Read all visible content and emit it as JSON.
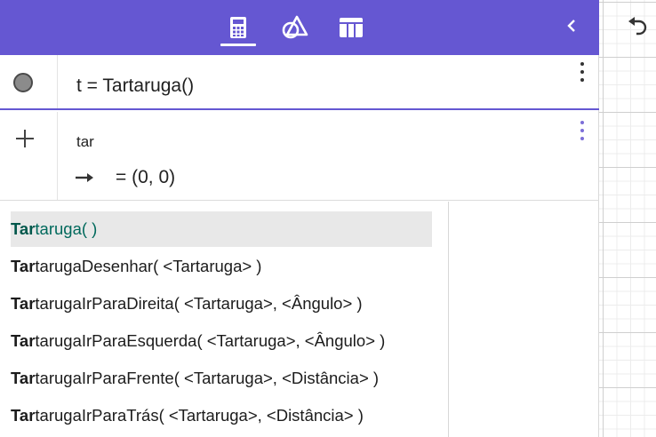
{
  "toolbar": {
    "tabs": [
      {
        "icon": "calculator-icon",
        "active": true
      },
      {
        "icon": "geometry-tools-icon",
        "active": false
      },
      {
        "icon": "table-icon",
        "active": false
      }
    ],
    "collapse_icon": "chevron-left-icon",
    "color": "#6557d2"
  },
  "graphics": {
    "undo_icon": "undo-icon"
  },
  "algebra": {
    "row1": {
      "expression": "t = Tartaruga()",
      "visibility_icon": "visibility-dot-icon"
    },
    "row2": {
      "input": "tar",
      "preview": "= (0, 0)",
      "add_icon": "plus-icon"
    }
  },
  "suggestions": {
    "typed": "Tar",
    "items": [
      {
        "bold": "Tar",
        "rest": "taruga( )"
      },
      {
        "bold": "Tar",
        "rest": "tarugaDesenhar( <Tartaruga> )"
      },
      {
        "bold": "Tar",
        "rest": "tarugaIrParaDireita( <Tartaruga>, <Ângulo> )"
      },
      {
        "bold": "Tar",
        "rest": "tarugaIrParaEsquerda( <Tartaruga>, <Ângulo> )"
      },
      {
        "bold": "Tar",
        "rest": "tarugaIrParaFrente( <Tartaruga>, <Distância> )"
      },
      {
        "bold": "Tar",
        "rest": "tarugaIrParaTrás( <Tartaruga>, <Distância> )"
      }
    ],
    "selected_index": 0
  }
}
